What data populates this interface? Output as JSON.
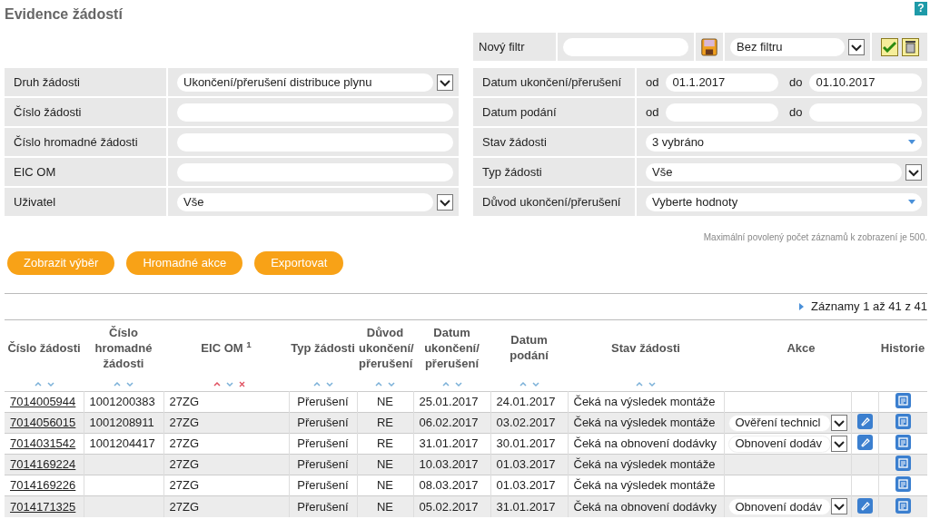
{
  "title": "Evidence žádostí",
  "help": "?",
  "filter_bar": {
    "label": "Nový filtr",
    "saved_filter": "Bez filtru"
  },
  "left_form": [
    {
      "label": "Druh žádosti",
      "kind": "select",
      "value": "Ukončení/přerušení distribuce plynu"
    },
    {
      "label": "Číslo žádosti",
      "kind": "input"
    },
    {
      "label": "Číslo hromadné žádosti",
      "kind": "input"
    },
    {
      "label": "EIC OM",
      "kind": "input"
    },
    {
      "label": "Uživatel",
      "kind": "select",
      "value": "Vše"
    }
  ],
  "right_form": [
    {
      "label": "Datum ukončení/přerušení",
      "kind": "date_range",
      "from_label": "od",
      "from": "01.1.2017",
      "to_label": "do",
      "to": "01.10.2017"
    },
    {
      "label": "Datum podání",
      "kind": "date_range",
      "from_label": "od",
      "to_label": "do"
    },
    {
      "label": "Stav žádosti",
      "kind": "multiselect",
      "value": "3 vybráno"
    },
    {
      "label": "Typ žádosti",
      "kind": "select",
      "value": "Vše"
    },
    {
      "label": "Důvod ukončení/přerušení",
      "kind": "multiselect",
      "value": "Vyberte hodnoty"
    }
  ],
  "note": "Maximální povolený počet záznamů k zobrazení je 500.",
  "buttons": [
    "Zobrazit výběr",
    "Hromadné akce",
    "Exportovat"
  ],
  "records": "Záznamy 1 až 41 z 41",
  "table": {
    "columns": [
      {
        "label": "Číslo žádosti",
        "sorted": false
      },
      {
        "label": "Číslo hromadné žádosti",
        "sorted": false
      },
      {
        "label": "EIC OM $^{1}$",
        "sorted": true
      },
      {
        "label": "Typ žádosti",
        "sorted": false
      },
      {
        "label": "Důvod ukončení/ přerušení",
        "sorted": false
      },
      {
        "label": "Datum ukončení/ přerušení",
        "sorted": false
      },
      {
        "label": "Datum podání",
        "sorted": false
      },
      {
        "label": "Stav žádosti",
        "sorted": false
      },
      {
        "label": "Akce"
      },
      {
        "label": "Historie"
      }
    ],
    "rows": [
      {
        "id": "7014005944",
        "bulk_id": "1001200383",
        "eic": "27ZG",
        "type": "Přerušení",
        "reason": "NE",
        "end_date": "25.01.2017",
        "filed": "24.01.2017",
        "status": "Čeká na výsledek montáže",
        "editable": false
      },
      {
        "id": "7014056015",
        "bulk_id": "1001208911",
        "eic": "27ZG",
        "type": "Přerušení",
        "reason": "RE",
        "end_date": "06.02.2017",
        "filed": "03.02.2017",
        "status": "Čeká na výsledek montáže",
        "action": "Ověření technicl",
        "editable": true
      },
      {
        "id": "7014031542",
        "bulk_id": "1001204417",
        "eic": "27ZG",
        "type": "Přerušení",
        "reason": "RE",
        "end_date": "31.01.2017",
        "filed": "30.01.2017",
        "status": "Čeká na obnovení dodávky",
        "action": "Obnovení dodáv",
        "editable": true
      },
      {
        "id": "7014169224",
        "eic": "27ZG",
        "type": "Přerušení",
        "reason": "NE",
        "end_date": "10.03.2017",
        "filed": "01.03.2017",
        "status": "Čeká na výsledek montáže",
        "editable": false
      },
      {
        "id": "7014169226",
        "eic": "27ZG",
        "type": "Přerušení",
        "reason": "NE",
        "end_date": "08.03.2017",
        "filed": "01.03.2017",
        "status": "Čeká na výsledek montáže",
        "editable": false
      },
      {
        "id": "7014171325",
        "eic": "27ZG",
        "type": "Přerušení",
        "reason": "NE",
        "end_date": "05.02.2017",
        "filed": "31.01.2017",
        "status": "Čeká na obnovení dodávky",
        "action": "Obnovení dodáv",
        "editable": true
      }
    ]
  }
}
